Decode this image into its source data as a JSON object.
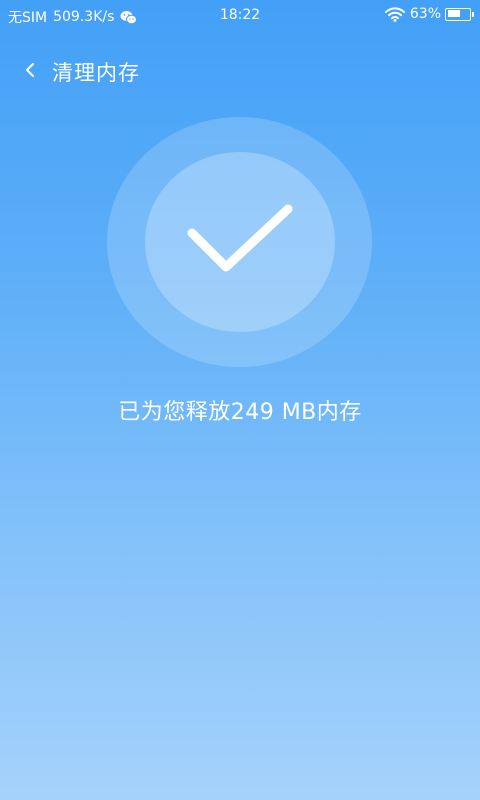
{
  "status_bar": {
    "carrier": "无SIM",
    "network_speed": "509.3K/s",
    "notification_icon": "wechat-icon",
    "time": "18:22",
    "wifi_icon": "wifi-icon",
    "battery_percent": "63%",
    "battery_level": 0.63
  },
  "header": {
    "back_icon": "chevron-left-icon",
    "title": "清理内存"
  },
  "result": {
    "icon": "checkmark-icon",
    "message": "已为您释放249 MB内存"
  },
  "colors": {
    "gradient_top": "#43a0f7",
    "gradient_bottom": "#a5d2fb",
    "text": "#ffffff"
  }
}
